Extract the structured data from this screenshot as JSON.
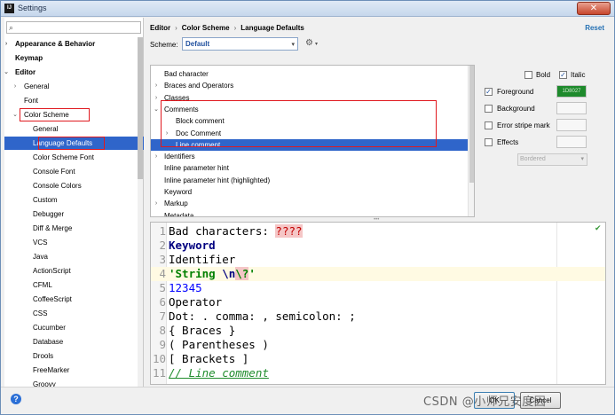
{
  "window": {
    "title": "Settings",
    "app_icon_label": "IJ",
    "close_label": "✕"
  },
  "search": {
    "value": "",
    "placeholder": ""
  },
  "tree": {
    "items": [
      {
        "label": "Appearance & Behavior",
        "arrow": "›",
        "bold": true
      },
      {
        "label": "Keymap",
        "arrow": "",
        "bold": true
      },
      {
        "label": "Editor",
        "arrow": "⌄",
        "bold": true
      },
      {
        "label": "General",
        "arrow": "›",
        "bold": false
      },
      {
        "label": "Font",
        "arrow": "",
        "bold": false
      },
      {
        "label": "Color Scheme",
        "arrow": "⌄",
        "bold": false
      },
      {
        "label": "General",
        "arrow": "",
        "bold": false
      },
      {
        "label": "Language Defaults",
        "arrow": "",
        "bold": false,
        "selected": true
      },
      {
        "label": "Color Scheme Font",
        "arrow": "",
        "bold": false
      },
      {
        "label": "Console Font",
        "arrow": "",
        "bold": false
      },
      {
        "label": "Console Colors",
        "arrow": "",
        "bold": false
      },
      {
        "label": "Custom",
        "arrow": "",
        "bold": false
      },
      {
        "label": "Debugger",
        "arrow": "",
        "bold": false
      },
      {
        "label": "Diff & Merge",
        "arrow": "",
        "bold": false
      },
      {
        "label": "VCS",
        "arrow": "",
        "bold": false
      },
      {
        "label": "Java",
        "arrow": "",
        "bold": false
      },
      {
        "label": "ActionScript",
        "arrow": "",
        "bold": false
      },
      {
        "label": "CFML",
        "arrow": "",
        "bold": false
      },
      {
        "label": "CoffeeScript",
        "arrow": "",
        "bold": false
      },
      {
        "label": "CSS",
        "arrow": "",
        "bold": false
      },
      {
        "label": "Cucumber",
        "arrow": "",
        "bold": false
      },
      {
        "label": "Database",
        "arrow": "",
        "bold": false
      },
      {
        "label": "Drools",
        "arrow": "",
        "bold": false
      },
      {
        "label": "FreeMarker",
        "arrow": "",
        "bold": false
      },
      {
        "label": "Groovy",
        "arrow": "",
        "bold": false
      }
    ]
  },
  "breadcrumb": [
    "Editor",
    "Color Scheme",
    "Language Defaults"
  ],
  "breadcrumb_sep": "›",
  "reset_label": "Reset",
  "scheme": {
    "label": "Scheme:",
    "value": "Default",
    "arrow": "▾"
  },
  "elements": [
    {
      "label": "Bad character",
      "arrow": ""
    },
    {
      "label": "Braces and Operators",
      "arrow": "›"
    },
    {
      "label": "Classes",
      "arrow": "›"
    },
    {
      "label": "Comments",
      "arrow": "⌄"
    },
    {
      "label": "Block comment",
      "arrow": ""
    },
    {
      "label": "Doc Comment",
      "arrow": "›"
    },
    {
      "label": "Line comment",
      "arrow": "",
      "selected": true
    },
    {
      "label": "Identifiers",
      "arrow": "›"
    },
    {
      "label": "Inline parameter hint",
      "arrow": ""
    },
    {
      "label": "Inline parameter hint (highlighted)",
      "arrow": ""
    },
    {
      "label": "Keyword",
      "arrow": ""
    },
    {
      "label": "Markup",
      "arrow": "›"
    },
    {
      "label": "Metadata",
      "arrow": ""
    }
  ],
  "attributes": {
    "bold": {
      "label": "Bold",
      "checked": false
    },
    "italic": {
      "label": "Italic",
      "checked": true
    },
    "foreground": {
      "label": "Foreground",
      "checked": true,
      "value": "1D8027"
    },
    "background": {
      "label": "Background",
      "checked": false
    },
    "error_stripe": {
      "label": "Error stripe mark",
      "checked": false
    },
    "effects": {
      "label": "Effects",
      "checked": false
    },
    "effect_type": "Bordered",
    "check_glyph": "✓"
  },
  "preview": {
    "lines": [
      {
        "n": "1",
        "parts": [
          [
            "",
            "Bad characters: "
          ],
          [
            "bad",
            "????"
          ]
        ]
      },
      {
        "n": "2",
        "parts": [
          [
            "kw",
            "Keyword"
          ]
        ]
      },
      {
        "n": "3",
        "parts": [
          [
            "",
            "Identifier"
          ]
        ]
      },
      {
        "n": "4",
        "current": true,
        "parts": [
          [
            "str",
            "'String "
          ],
          [
            "esc",
            "\\n"
          ],
          [
            "esc-bad",
            "\\?"
          ],
          [
            "str",
            "'"
          ]
        ]
      },
      {
        "n": "5",
        "parts": [
          [
            "num",
            "12345"
          ]
        ]
      },
      {
        "n": "6",
        "parts": [
          [
            "",
            "Operator"
          ]
        ]
      },
      {
        "n": "7",
        "parts": [
          [
            "",
            "Dot: . comma: , semicolon: ;"
          ]
        ]
      },
      {
        "n": "8",
        "parts": [
          [
            "",
            "{ Braces }"
          ]
        ]
      },
      {
        "n": "9",
        "parts": [
          [
            "",
            "( Parentheses )"
          ]
        ]
      },
      {
        "n": "10",
        "parts": [
          [
            "",
            "[ Brackets ]"
          ]
        ]
      },
      {
        "n": "11",
        "parts": [
          [
            "cmt",
            "// Line comment"
          ]
        ]
      }
    ]
  },
  "buttons": {
    "ok": "OK",
    "cancel": "Cancel",
    "help": "?"
  },
  "watermark": "CSDN @小师兄安度因",
  "colors": {
    "accent": "#2f65ca",
    "annotation": "#e0191f",
    "comment": "#1f8c2c"
  }
}
